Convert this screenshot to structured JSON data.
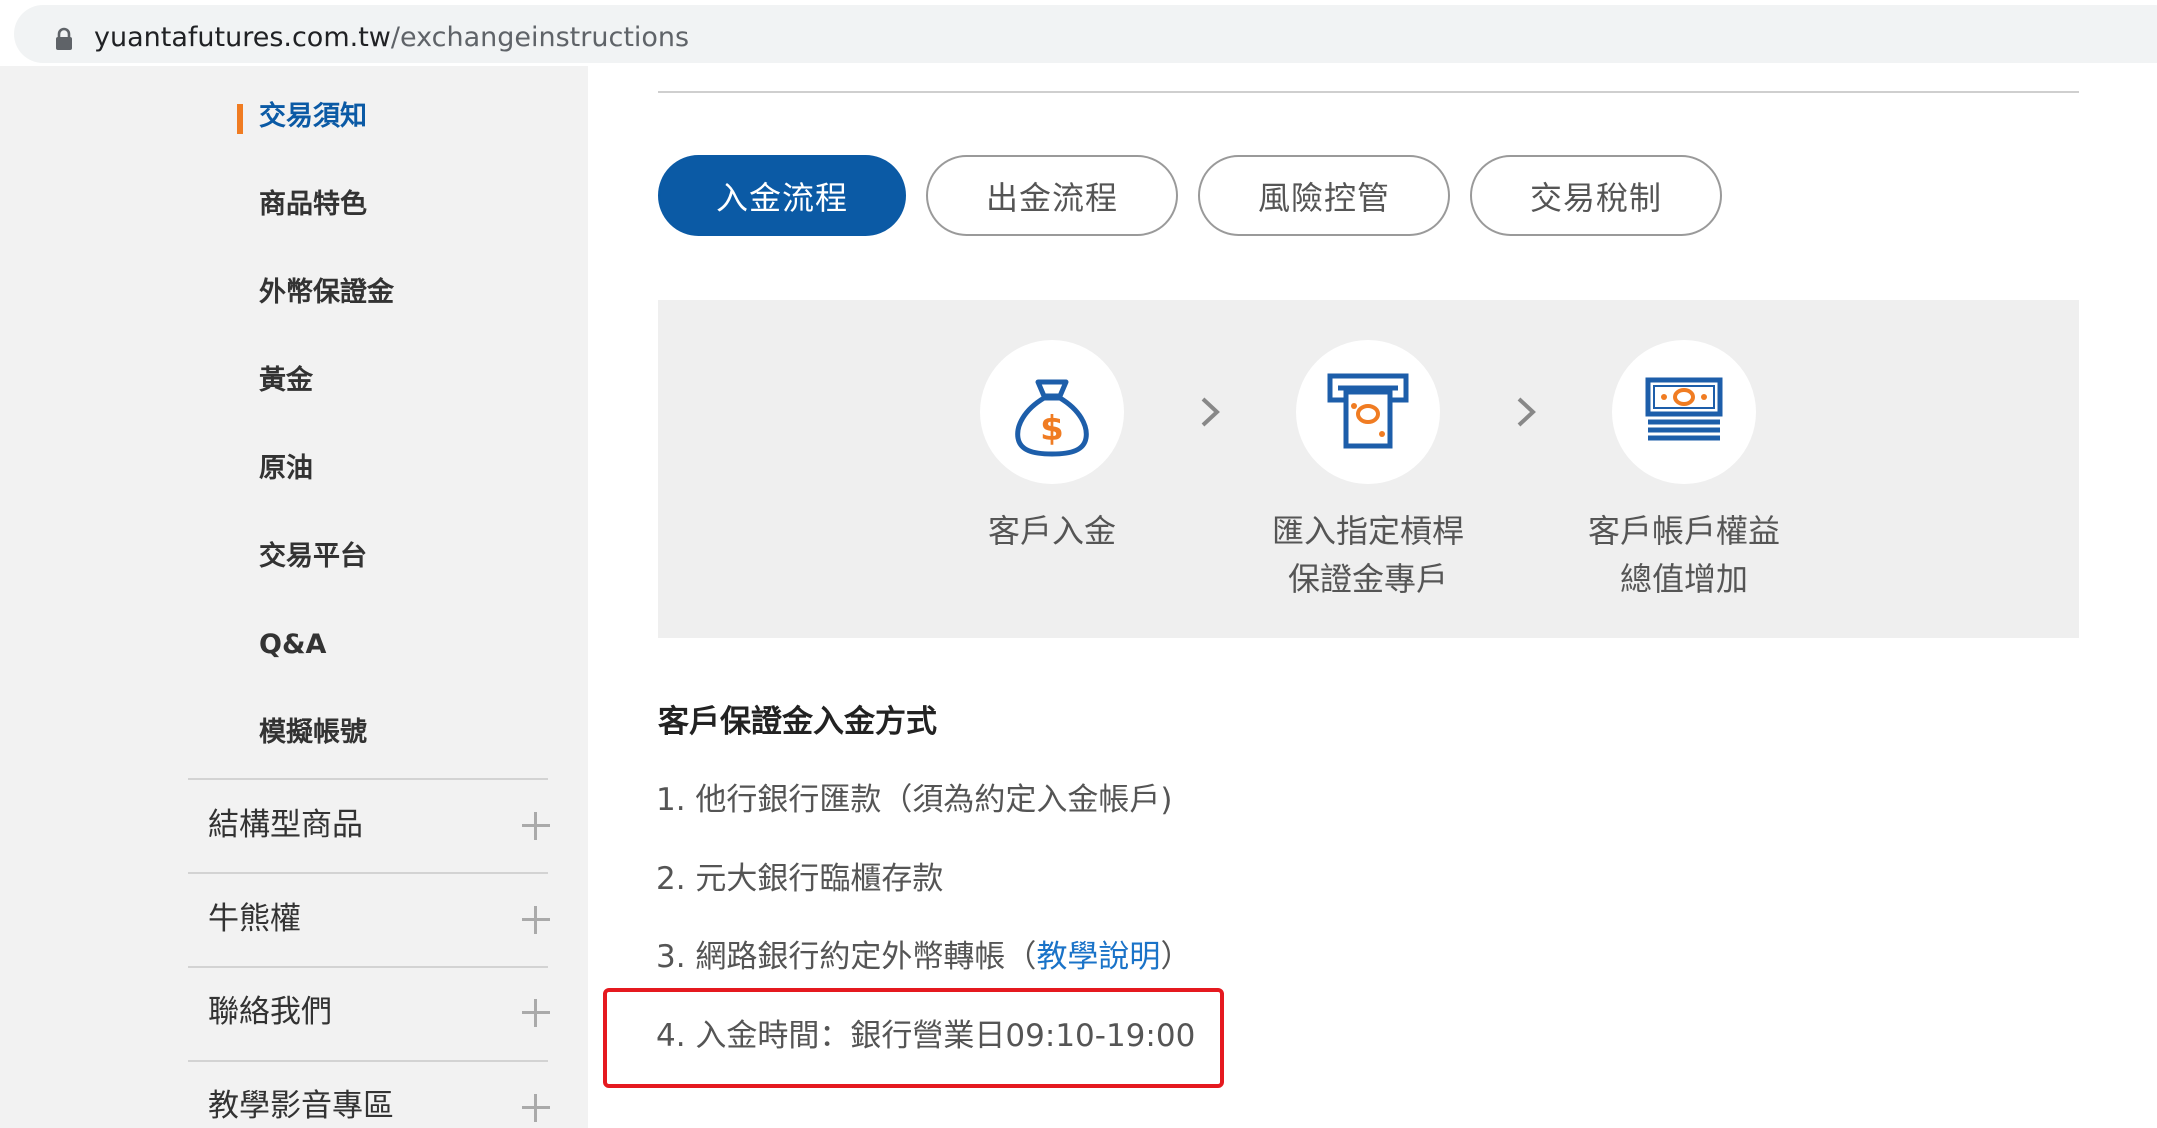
{
  "address_bar": {
    "domain": "yuantafutures.com.tw",
    "path": "/exchangeinstructions"
  },
  "sidebar": {
    "sub_items": [
      {
        "label": "交易須知",
        "active": true
      },
      {
        "label": "商品特色"
      },
      {
        "label": "外幣保證金"
      },
      {
        "label": "黃金"
      },
      {
        "label": "原油"
      },
      {
        "label": "交易平台"
      },
      {
        "label": "Q&A"
      },
      {
        "label": "模擬帳號"
      }
    ],
    "categories": [
      {
        "label": "結構型商品"
      },
      {
        "label": "牛熊權"
      },
      {
        "label": "聯絡我們"
      },
      {
        "label": "教學影音專區"
      }
    ]
  },
  "tabs": [
    {
      "label": "入金流程",
      "active": true
    },
    {
      "label": "出金流程"
    },
    {
      "label": "風險控管"
    },
    {
      "label": "交易稅制"
    }
  ],
  "flow": {
    "steps": [
      {
        "icon": "money-bag-icon",
        "lines": [
          "客戶入金"
        ]
      },
      {
        "icon": "atm-icon",
        "lines": [
          "匯入指定槓桿",
          "保證金專戶"
        ]
      },
      {
        "icon": "cash-stack-icon",
        "lines": [
          "客戶帳戶權益",
          "總值增加"
        ]
      }
    ],
    "arrow_icon": "chevron-right-icon"
  },
  "deposit": {
    "title": "客戶保證金入金方式",
    "items": [
      {
        "text": "1. 他行銀行匯款（須為約定入金帳戶)"
      },
      {
        "text": "2. 元大銀行臨櫃存款"
      },
      {
        "text_before": "3. 網路銀行約定外幣轉帳（",
        "link": "教學說明",
        "text_after": "）"
      },
      {
        "text": "4. 入金時間：銀行營業日09:10-19:00",
        "highlighted": true
      }
    ]
  },
  "colors": {
    "brand_blue": "#0b5aa5",
    "accent_orange": "#f07c22",
    "highlight_red": "#e5191f",
    "link_blue": "#1a73c8"
  }
}
